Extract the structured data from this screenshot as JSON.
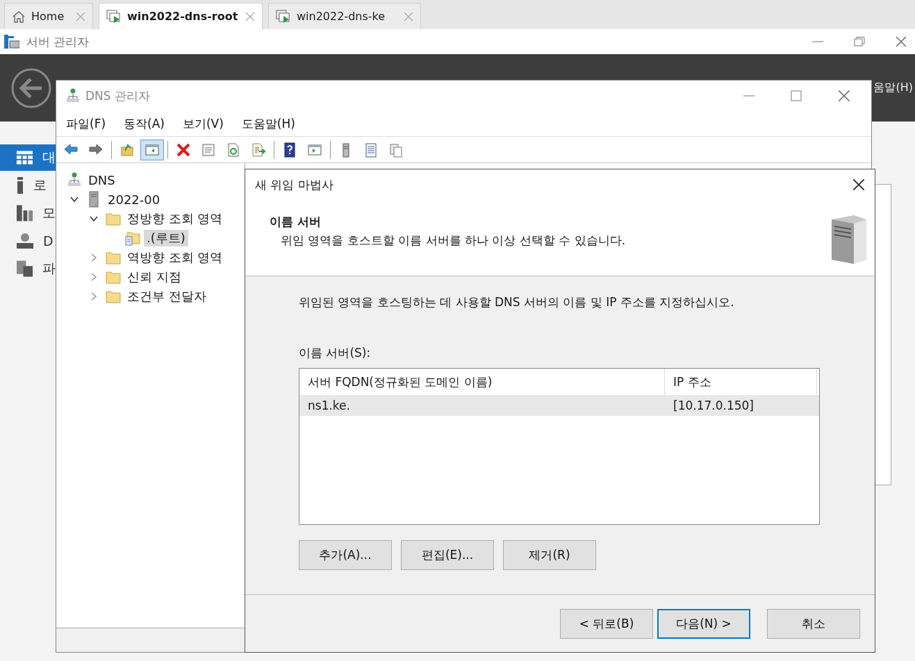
{
  "browser_tabs": [
    {
      "label": "Home",
      "kind": "home",
      "selected": false
    },
    {
      "label": "win2022-dns-root",
      "kind": "vm",
      "selected": true
    },
    {
      "label": "win2022-dns-ke",
      "kind": "vm",
      "selected": false
    }
  ],
  "server_manager": {
    "title": "서버 관리자",
    "header_menu_fragment": "움말(H)",
    "sidebar": [
      {
        "label": "대",
        "kind": "dashboard",
        "selected": true
      },
      {
        "label": "로",
        "kind": "local",
        "selected": false
      },
      {
        "label": "모",
        "kind": "all",
        "selected": false
      },
      {
        "label": "D",
        "kind": "dns",
        "selected": false
      },
      {
        "label": "파",
        "kind": "files",
        "selected": false
      }
    ]
  },
  "dns_manager": {
    "title": "DNS 관리자",
    "menu": [
      "파일(F)",
      "동작(A)",
      "보기(V)",
      "도움말(H)"
    ],
    "toolbar": [
      {
        "kind": "back",
        "pressed": false
      },
      {
        "kind": "forward",
        "pressed": false
      },
      {
        "kind": "separator"
      },
      {
        "kind": "up",
        "pressed": false
      },
      {
        "kind": "console-tree",
        "pressed": true
      },
      {
        "kind": "separator"
      },
      {
        "kind": "delete",
        "pressed": false
      },
      {
        "kind": "properties",
        "pressed": false
      },
      {
        "kind": "refresh",
        "pressed": false
      },
      {
        "kind": "export",
        "pressed": false
      },
      {
        "kind": "separator"
      },
      {
        "kind": "help",
        "pressed": false
      },
      {
        "kind": "action-pane",
        "pressed": false
      },
      {
        "kind": "separator"
      },
      {
        "kind": "server",
        "pressed": false
      },
      {
        "kind": "list",
        "pressed": false
      },
      {
        "kind": "copy",
        "pressed": false
      }
    ],
    "tree": [
      {
        "label": "DNS",
        "kind": "root",
        "selected": false,
        "children": [
          {
            "label": "2022-00",
            "kind": "server",
            "selected": false,
            "expanded": true,
            "children": [
              {
                "label": "정방향 조회 영역",
                "kind": "folder",
                "selected": false,
                "expanded": true,
                "children": [
                  {
                    "label": ".(루트)",
                    "kind": "zone",
                    "selected": true
                  }
                ]
              },
              {
                "label": "역방향 조회 영역",
                "kind": "folder",
                "selected": false,
                "expanded": false
              },
              {
                "label": "신뢰 지점",
                "kind": "folder",
                "selected": false,
                "expanded": false
              },
              {
                "label": "조건부 전달자",
                "kind": "folder",
                "selected": false,
                "expanded": false
              }
            ]
          }
        ]
      }
    ]
  },
  "wizard": {
    "title": "새 위임 마법사",
    "heading": "이름 서버",
    "subheading": "위임 영역을 호스트할 이름 서버를 하나 이상 선택할 수 있습니다.",
    "instruction": "위임된 영역을 호스팅하는 데 사용할 DNS 서버의 이름 및 IP 주소를 지정하십시오.",
    "list_label": "이름 서버(S):",
    "table": {
      "columns": [
        "서버 FQDN(정규화된 도메인 이름)",
        "IP 주소"
      ],
      "rows": [
        {
          "cells": [
            "ns1.ke.",
            "[10.17.0.150]"
          ],
          "selected": true
        }
      ]
    },
    "list_buttons": [
      "추가(A)...",
      "편집(E)...",
      "제거(R)"
    ],
    "nav_buttons": [
      {
        "label": "< 뒤로(B)",
        "default": false
      },
      {
        "label": "다음(N) >",
        "default": true
      },
      {
        "label": "취소",
        "default": false
      }
    ]
  }
}
